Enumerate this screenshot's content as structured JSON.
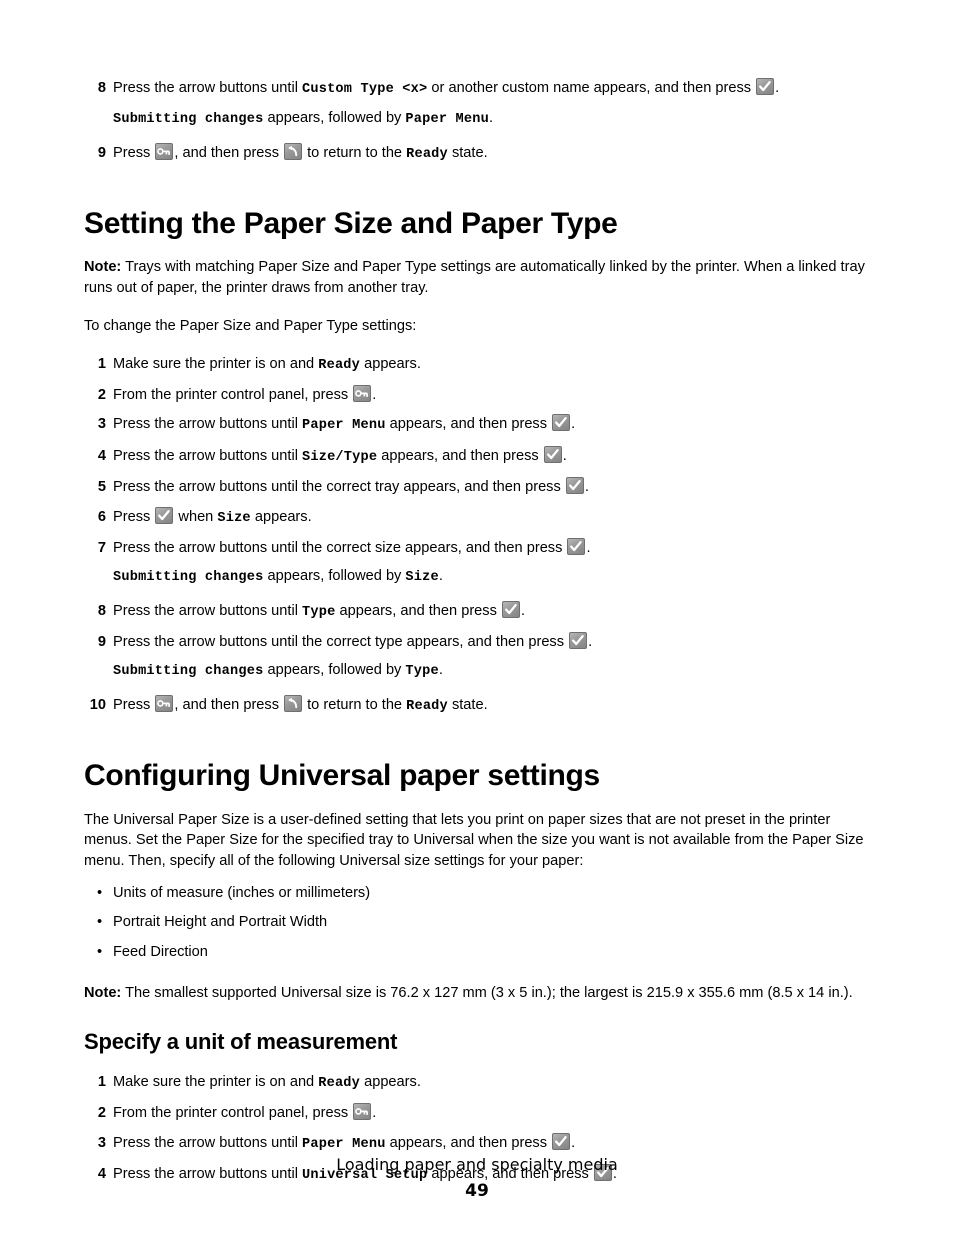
{
  "document": {
    "page_number": "49",
    "running_footer": "Loading paper and specialty media"
  },
  "icons": {
    "check": "check-button-icon",
    "menu": "menu-key-button-icon",
    "back": "back-arrow-button-icon"
  },
  "top_steps": {
    "step8": {
      "number": "8",
      "text_a": "Press the arrow buttons until ",
      "mono_a": "Custom Type <x>",
      "text_b": " or another custom name appears, and then press ",
      "text_c": ".",
      "sub_mono_a": "Submitting changes",
      "sub_text_a": " appears, followed by ",
      "sub_mono_b": "Paper Menu",
      "sub_text_b": "."
    },
    "step9": {
      "number": "9",
      "text_a": "Press ",
      "text_b": ", and then press ",
      "text_c": " to return to the ",
      "mono_a": "Ready",
      "text_d": " state."
    }
  },
  "section_size_type": {
    "heading": "Setting the Paper Size and Paper Type",
    "note_label": "Note:",
    "note_text": " Trays with matching Paper Size and Paper Type settings are automatically linked by the printer. When a linked tray runs out of paper, the printer draws from another tray.",
    "intro": "To change the Paper Size and Paper Type settings:",
    "steps": [
      {
        "number": "1",
        "text_a": "Make sure the printer is on and ",
        "mono_a": "Ready",
        "text_b": " appears."
      },
      {
        "number": "2",
        "text_a": "From the printer control panel, press ",
        "text_b": "."
      },
      {
        "number": "3",
        "text_a": "Press the arrow buttons until ",
        "mono_a": "Paper Menu",
        "text_b": " appears, and then press ",
        "text_c": "."
      },
      {
        "number": "4",
        "text_a": "Press the arrow buttons until ",
        "mono_a": "Size/Type",
        "text_b": " appears, and then press ",
        "text_c": "."
      },
      {
        "number": "5",
        "text_a": "Press the arrow buttons until the correct tray appears, and then press ",
        "text_b": "."
      },
      {
        "number": "6",
        "text_a": "Press ",
        "text_b": " when ",
        "mono_a": "Size",
        "text_c": " appears."
      },
      {
        "number": "7",
        "text_a": "Press the arrow buttons until the correct size appears, and then press ",
        "text_b": ".",
        "sub_mono_a": "Submitting changes",
        "sub_text_a": " appears, followed by ",
        "sub_mono_b": "Size",
        "sub_text_b": "."
      },
      {
        "number": "8",
        "text_a": "Press the arrow buttons until ",
        "mono_a": "Type",
        "text_b": " appears, and then press ",
        "text_c": "."
      },
      {
        "number": "9",
        "text_a": "Press the arrow buttons until the correct type appears, and then press ",
        "text_b": ".",
        "sub_mono_a": "Submitting changes",
        "sub_text_a": " appears, followed by ",
        "sub_mono_b": "Type",
        "sub_text_b": "."
      },
      {
        "number": "10",
        "text_a": "Press ",
        "text_b": ", and then press ",
        "text_c": " to return to the ",
        "mono_a": "Ready",
        "text_d": " state."
      }
    ]
  },
  "section_universal": {
    "heading": "Configuring Universal paper settings",
    "intro": "The Universal Paper Size is a user-defined setting that lets you print on paper sizes that are not preset in the printer menus. Set the Paper Size for the specified tray to Universal when the size you want is not available from the Paper Size menu. Then, specify all of the following Universal size settings for your paper:",
    "bullets": [
      "Units of measure (inches or millimeters)",
      "Portrait Height and Portrait Width",
      "Feed Direction"
    ],
    "note_label": "Note:",
    "note_text": " The smallest supported Universal size is 76.2 x 127 mm (3  x 5 in.); the largest is 215.9 x 355.6 mm (8.5 x 14 in.).",
    "subheading": "Specify a unit of measurement",
    "steps": [
      {
        "number": "1",
        "text_a": "Make sure the printer is on and ",
        "mono_a": "Ready",
        "text_b": " appears."
      },
      {
        "number": "2",
        "text_a": "From the printer control panel, press ",
        "text_b": "."
      },
      {
        "number": "3",
        "text_a": "Press the arrow buttons until ",
        "mono_a": "Paper Menu",
        "text_b": " appears, and then press ",
        "text_c": "."
      },
      {
        "number": "4",
        "text_a": "Press the arrow buttons until ",
        "mono_a": "Universal Setup",
        "text_b": " appears, and then press ",
        "text_c": "."
      }
    ]
  }
}
